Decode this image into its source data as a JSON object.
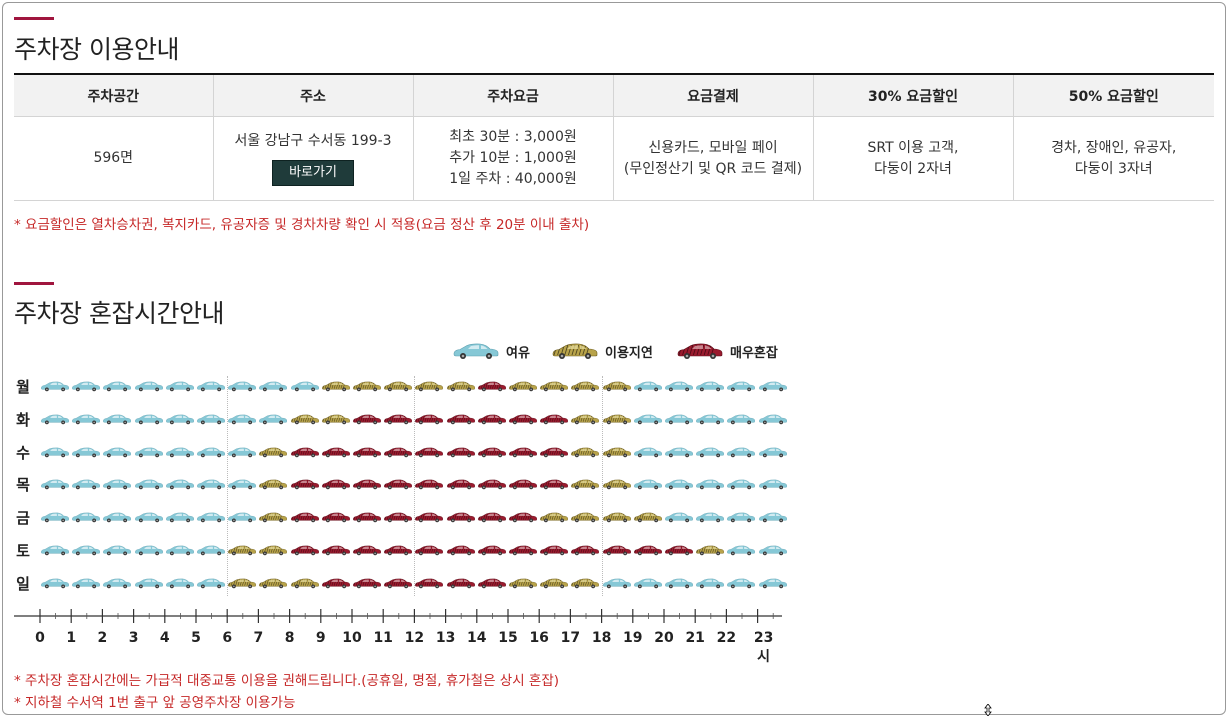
{
  "section1": {
    "title": "주차장 이용안내",
    "table": {
      "headers": [
        "주차공간",
        "주소",
        "주차요금",
        "요금결제",
        "30% 요금할인",
        "50% 요금할인"
      ],
      "spaces": "596면",
      "address": "서울 강남구 수서동 199-3",
      "goto_label": "바로가기",
      "fees": [
        "최초 30분 : 3,000원",
        "추가 10분 : 1,000원",
        "1일 주차 : 40,000원"
      ],
      "payment": [
        "신용카드, 모바일 페이",
        "(무인정산기 및 QR 코드 결제)"
      ],
      "discount30": [
        "SRT 이용 고객,",
        "다둥이 2자녀"
      ],
      "discount50": [
        "경차, 장애인, 유공자,",
        "다둥이 3자녀"
      ]
    },
    "note": "* 요금할인은 열차승차권, 복지카드, 유공자증 및 경차차량 확인 시 적용(요금 정산 후 20분 이내 출차)"
  },
  "section2": {
    "title": "주차장 혼잡시간안내",
    "legend": [
      {
        "label": "여유",
        "level": 0,
        "color": "#86c8d6"
      },
      {
        "label": "이용지연",
        "level": 1,
        "color": "#b8a34a"
      },
      {
        "label": "매우혼잡",
        "level": 2,
        "color": "#9a1b2e"
      }
    ],
    "days": [
      "월",
      "화",
      "수",
      "목",
      "금",
      "토",
      "일"
    ],
    "hour_labels": [
      "0",
      "1",
      "2",
      "3",
      "4",
      "5",
      "6",
      "7",
      "8",
      "9",
      "10",
      "11",
      "12",
      "13",
      "14",
      "15",
      "16",
      "17",
      "18",
      "19",
      "20",
      "21",
      "22",
      "23시"
    ],
    "congestion": [
      [
        0,
        0,
        0,
        0,
        0,
        0,
        0,
        0,
        0,
        1,
        1,
        1,
        1,
        1,
        2,
        1,
        1,
        1,
        1,
        0,
        0,
        0,
        0,
        0
      ],
      [
        0,
        0,
        0,
        0,
        0,
        0,
        0,
        0,
        1,
        1,
        2,
        2,
        2,
        2,
        2,
        2,
        2,
        1,
        1,
        0,
        0,
        0,
        0,
        0
      ],
      [
        0,
        0,
        0,
        0,
        0,
        0,
        0,
        1,
        2,
        2,
        2,
        2,
        2,
        2,
        2,
        2,
        2,
        1,
        1,
        0,
        0,
        0,
        0,
        0
      ],
      [
        0,
        0,
        0,
        0,
        0,
        0,
        0,
        1,
        2,
        2,
        2,
        2,
        2,
        2,
        2,
        2,
        2,
        1,
        1,
        0,
        0,
        0,
        0,
        0
      ],
      [
        0,
        0,
        0,
        0,
        0,
        0,
        0,
        1,
        2,
        2,
        2,
        2,
        2,
        2,
        2,
        2,
        1,
        1,
        1,
        1,
        0,
        0,
        0,
        0
      ],
      [
        0,
        0,
        0,
        0,
        0,
        0,
        1,
        1,
        2,
        2,
        2,
        2,
        2,
        2,
        2,
        2,
        2,
        2,
        2,
        2,
        2,
        1,
        0,
        0
      ],
      [
        0,
        0,
        0,
        0,
        0,
        0,
        1,
        1,
        1,
        2,
        2,
        2,
        2,
        2,
        2,
        1,
        1,
        1,
        0,
        0,
        0,
        0,
        0,
        0
      ]
    ],
    "notes": [
      "* 주차장 혼잡시간에는 가급적 대중교통 이용을 권해드립니다.(공휴일, 명절, 휴가철은 상시 혼잡)",
      "* 지하철 수서역 1번 출구 앞 공영주차장 이용가능"
    ]
  }
}
